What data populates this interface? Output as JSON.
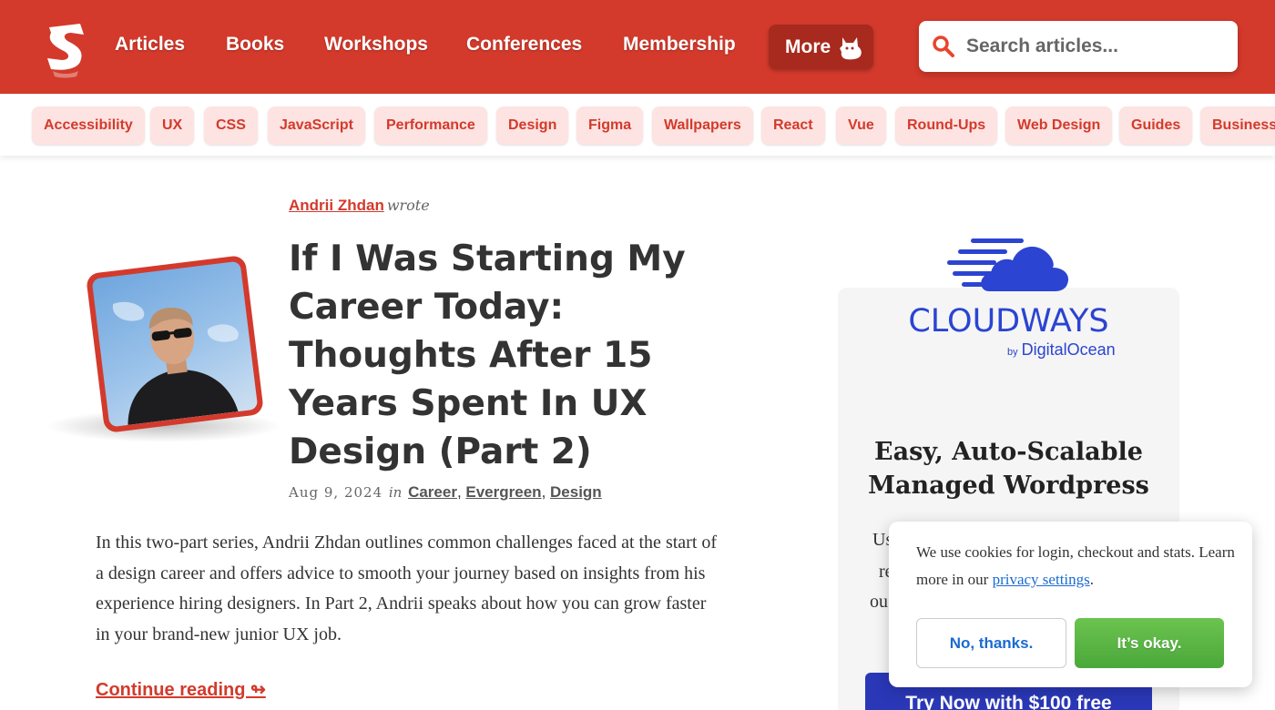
{
  "header": {
    "brand_color": "#d33a2c",
    "logo_icon": "smashing-s-logo-icon",
    "nav": [
      {
        "label": "Articles"
      },
      {
        "label": "Books"
      },
      {
        "label": "Workshops"
      },
      {
        "label": "Conferences"
      },
      {
        "label": "Membership"
      }
    ],
    "more_label": "More",
    "more_icon": "cat-icon",
    "search": {
      "placeholder": "Search articles...",
      "icon": "search-icon",
      "icon_color": "#e8452c"
    }
  },
  "tags": [
    "Accessibility",
    "UX",
    "CSS",
    "JavaScript",
    "Performance",
    "Design",
    "Figma",
    "Wallpapers",
    "React",
    "Vue",
    "Round-Ups",
    "Web Design",
    "Guides",
    "Business"
  ],
  "article": {
    "author": "Andrii Zhdan",
    "wrote": "wrote",
    "title": "If I Was Starting My Career Today: Thoughts After 15 Years Spent In UX Design (Part 2)",
    "date": "Aug 9, 2024",
    "in": "in",
    "categories": [
      "Career",
      "Evergreen",
      "Design"
    ],
    "excerpt": "In this two-part series, Andrii Zhdan outlines common challenges faced at the start of a design career and offers advice to smooth your journey based on insights from his experience hiring designers. In Part 2, Andrii speaks about how you can grow faster in your brand-new junior UX job.",
    "continue": "Continue reading ↬"
  },
  "ad": {
    "brand": "CLOUDWAYS",
    "by_small": "by",
    "by_name": "DigitalOcean",
    "brand_color": "#2b44d1",
    "heading": "Easy, Auto-Scalable Managed Wordpress",
    "partial_lines": [
      "Us",
      "re",
      "ou"
    ],
    "cta": "Try Now with $100 free"
  },
  "cookie": {
    "text_before": "We use cookies for login, checkout and stats. Learn more in our ",
    "link": "privacy settings",
    "text_after": ".",
    "decline": "No, thanks.",
    "accept": "It’s okay."
  }
}
